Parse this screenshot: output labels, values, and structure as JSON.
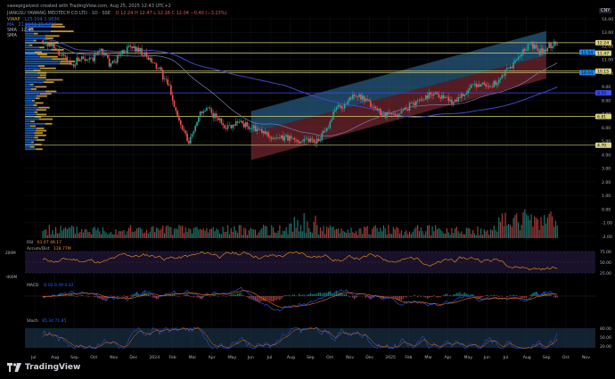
{
  "header": {
    "attribution": "sweepigalvest created with TradingView.com, Aug 25, 2025 12:43 UTC+2",
    "symbol_line": "JIANGSU YAWANG MEDTECH CO LTD · 1D · SSE",
    "ohlc": "O 12.24  H 12.47  L 12.16  C 12.04  −0.40 (−3.23%)",
    "vwap_label": "VWAP",
    "vwap_values": "125.104  1.9636",
    "ma1_label": "MA",
    "ma1_values": "21.9041  16.4716",
    "ma2_label": "SMA",
    "ma2_values": "12.43",
    "ma3_label": "SMA",
    "currency": "CNY"
  },
  "colors": {
    "background": "#000000",
    "candle_up": "#26a69a",
    "candle_down": "#ef5350",
    "channel_upper_fill": "#2f6e9c",
    "channel_lower_fill": "#8a2f3a",
    "ma_fast": "#4a57e0",
    "ma_slow": "#3f46c9",
    "level_line": "#d8d27a",
    "support_line": "#3d4ef0",
    "volume_profile_up": "#1f6bd8",
    "volume_profile_down": "#d4a53a",
    "rsi": "#f7931a",
    "macd": "#2962ff",
    "signal": "#ff6d00",
    "stoch_k": "#2962ff",
    "stoch_d": "#ff6d00",
    "osc_band": "#1e3950"
  },
  "chart_data": {
    "type": "candlestick",
    "symbol": "JIANGSU YAWANG MEDTECH CO LTD",
    "interval": "1D",
    "x_labels": [
      "Jul",
      "Aug",
      "Sep",
      "Oct",
      "Nov",
      "Dec",
      "2024",
      "Feb",
      "Mar",
      "Apr",
      "May",
      "Jun",
      "Jul",
      "Aug",
      "Sep",
      "Oct",
      "Nov",
      "Dec",
      "2025",
      "Feb",
      "Mar",
      "Apr",
      "May",
      "Jun",
      "Jul",
      "Aug",
      "Sep",
      "Oct",
      "Nov"
    ],
    "y_ticks": [
      "14.00",
      "13.00",
      "12.00",
      "11.00",
      "10.00",
      "9.00",
      "8.00",
      "7.00",
      "6.00",
      "5.00",
      "4.00",
      "3.00",
      "2.00",
      "1.00",
      "0.00",
      "-1.00",
      "-2.00"
    ],
    "ylim": [
      -2.2,
      14.2
    ],
    "horizontal_levels": [
      {
        "price": 12.24,
        "label": "12.24",
        "color": "#d8d27a"
      },
      {
        "price": 11.47,
        "label": "11.47",
        "color": "#d8d27a"
      },
      {
        "price": 10.15,
        "label": "10.15",
        "color": "#d8d27a"
      },
      {
        "price": 10.04,
        "label": "10.04",
        "color": "#d8d27a"
      },
      {
        "price": 8.55,
        "label": "8.55",
        "color": "#3d4ef0"
      },
      {
        "price": 6.81,
        "label": "6.81",
        "color": "#d8d27a"
      },
      {
        "price": 4.7,
        "label": "4.70",
        "color": "#d8d27a"
      }
    ],
    "price_tags": [
      {
        "price": 12.24,
        "label": "12.24",
        "bg": "#d8d27a"
      },
      {
        "price": 11.54,
        "label": "11.54",
        "bg": "#1e88e5"
      },
      {
        "price": 11.47,
        "label": "11.47",
        "bg": "#d8d27a"
      },
      {
        "price": 10.15,
        "label": "10.15",
        "bg": "#d8d27a"
      },
      {
        "price": 10.04,
        "label": "10.04",
        "bg": "#1e88e5"
      },
      {
        "price": 8.55,
        "label": "8.55",
        "bg": "#3d4ef0"
      },
      {
        "price": 6.81,
        "label": "6.81",
        "bg": "#d8d27a"
      },
      {
        "price": 4.7,
        "label": "4.70",
        "bg": "#d8d27a"
      }
    ],
    "close_path": [
      {
        "m": "Jul",
        "v": 12.4
      },
      {
        "m": "Jul",
        "v": 11.9
      },
      {
        "m": "Aug",
        "v": 11.2
      },
      {
        "m": "Aug",
        "v": 10.6
      },
      {
        "m": "Sep",
        "v": 11.3
      },
      {
        "m": "Sep",
        "v": 10.9
      },
      {
        "m": "Oct",
        "v": 11.8
      },
      {
        "m": "Oct",
        "v": 10.5
      },
      {
        "m": "Nov",
        "v": 11.5
      },
      {
        "m": "Nov",
        "v": 11.9
      },
      {
        "m": "Dec",
        "v": 11.7
      },
      {
        "m": "Dec",
        "v": 10.9
      },
      {
        "m": "2024",
        "v": 10.2
      },
      {
        "m": "2024",
        "v": 8.9
      },
      {
        "m": "Feb",
        "v": 6.4
      },
      {
        "m": "Feb",
        "v": 4.8
      },
      {
        "m": "Mar",
        "v": 6.9
      },
      {
        "m": "Mar",
        "v": 7.3
      },
      {
        "m": "Apr",
        "v": 6.6
      },
      {
        "m": "Apr",
        "v": 6.0
      },
      {
        "m": "May",
        "v": 6.5
      },
      {
        "m": "May",
        "v": 6.1
      },
      {
        "m": "Jun",
        "v": 5.8
      },
      {
        "m": "Jun",
        "v": 5.5
      },
      {
        "m": "Jul",
        "v": 5.1
      },
      {
        "m": "Jul",
        "v": 5.3
      },
      {
        "m": "Aug",
        "v": 5.0
      },
      {
        "m": "Aug",
        "v": 5.2
      },
      {
        "m": "Sep",
        "v": 5.0
      },
      {
        "m": "Sep",
        "v": 5.6
      },
      {
        "m": "Oct",
        "v": 7.4
      },
      {
        "m": "Oct",
        "v": 7.6
      },
      {
        "m": "Nov",
        "v": 8.5
      },
      {
        "m": "Nov",
        "v": 8.0
      },
      {
        "m": "Dec",
        "v": 7.5
      },
      {
        "m": "Dec",
        "v": 7.0
      },
      {
        "m": "2025",
        "v": 6.9
      },
      {
        "m": "2025",
        "v": 7.2
      },
      {
        "m": "Feb",
        "v": 7.8
      },
      {
        "m": "Feb",
        "v": 8.1
      },
      {
        "m": "Mar",
        "v": 8.6
      },
      {
        "m": "Mar",
        "v": 8.3
      },
      {
        "m": "Apr",
        "v": 7.9
      },
      {
        "m": "Apr",
        "v": 8.4
      },
      {
        "m": "May",
        "v": 8.9
      },
      {
        "m": "May",
        "v": 9.3
      },
      {
        "m": "Jun",
        "v": 9.0
      },
      {
        "m": "Jun",
        "v": 9.6
      },
      {
        "m": "Jul",
        "v": 10.4
      },
      {
        "m": "Jul",
        "v": 11.2
      },
      {
        "m": "Aug",
        "v": 12.2
      },
      {
        "m": "Aug",
        "v": 11.5
      },
      {
        "m": "Aug",
        "v": 12.0
      },
      {
        "m": "Aug",
        "v": 12.3
      }
    ],
    "regression_channel": {
      "start_month": "Jun",
      "end_month": "Sep",
      "upper_start": 7.2,
      "upper_end": 13.1,
      "mid_start": 5.6,
      "mid_end": 11.3,
      "lower_start": 3.6,
      "lower_end": 9.6
    },
    "volume_profile_note": "left-side volume profile",
    "indicators": {
      "rsi": {
        "label": "RSI",
        "values": "61.47  49.17",
        "levels": [
          "75.00",
          "50.00",
          "25.00"
        ],
        "overlay_label": "Accum/Dist",
        "overlay_value": "128.77M",
        "left_ticks": [
          "200M",
          "-400M"
        ]
      },
      "macd": {
        "label": "MACD",
        "values": "-0.02  0.39  0.42",
        "left_ticks": [
          "-400M"
        ]
      },
      "stoch": {
        "label": "Stoch",
        "values": "85.34  71.85",
        "levels": [
          "80.00",
          "50.00",
          "20.00"
        ]
      }
    }
  },
  "footer": {
    "brand": "TradingView"
  }
}
